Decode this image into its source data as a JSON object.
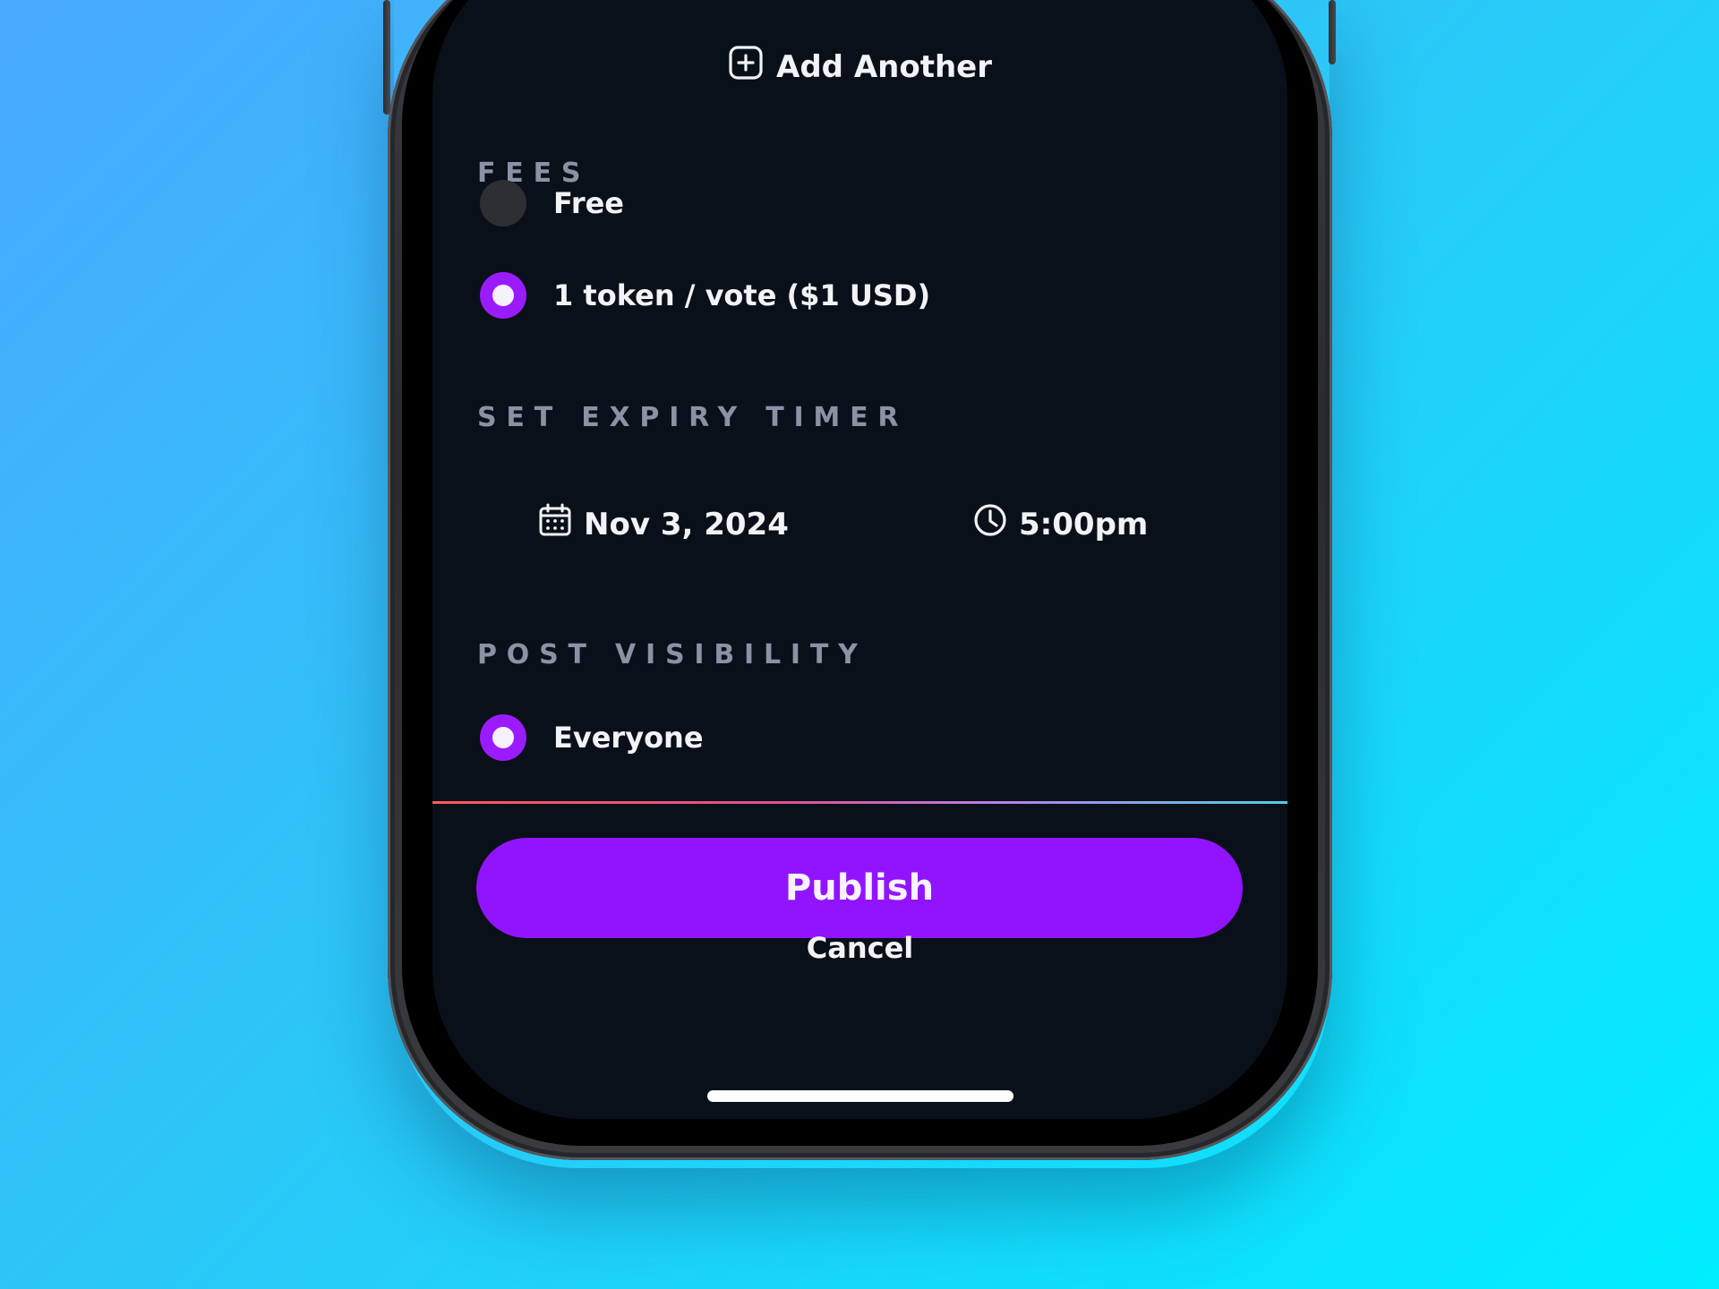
{
  "add_another": {
    "label": "Add Another",
    "icon": "plus-square-icon"
  },
  "fees": {
    "section_label": "FEES",
    "options": [
      {
        "label": "Free",
        "selected": false
      },
      {
        "label": "1 token / vote ($1 USD)",
        "selected": true
      }
    ]
  },
  "expiry": {
    "section_label": "SET EXPIRY TIMER",
    "date": {
      "value": "Nov 3, 2024",
      "icon": "calendar-icon"
    },
    "time": {
      "value": "5:00pm",
      "icon": "clock-icon"
    }
  },
  "visibility": {
    "section_label": "POST VISIBILITY",
    "options": [
      {
        "label": "Everyone",
        "selected": true
      }
    ]
  },
  "actions": {
    "publish_label": "Publish",
    "cancel_label": "Cancel"
  },
  "colors": {
    "accent": "#9214ff",
    "screen_bg": "#0a1019",
    "section_label": "#8a92a5"
  }
}
